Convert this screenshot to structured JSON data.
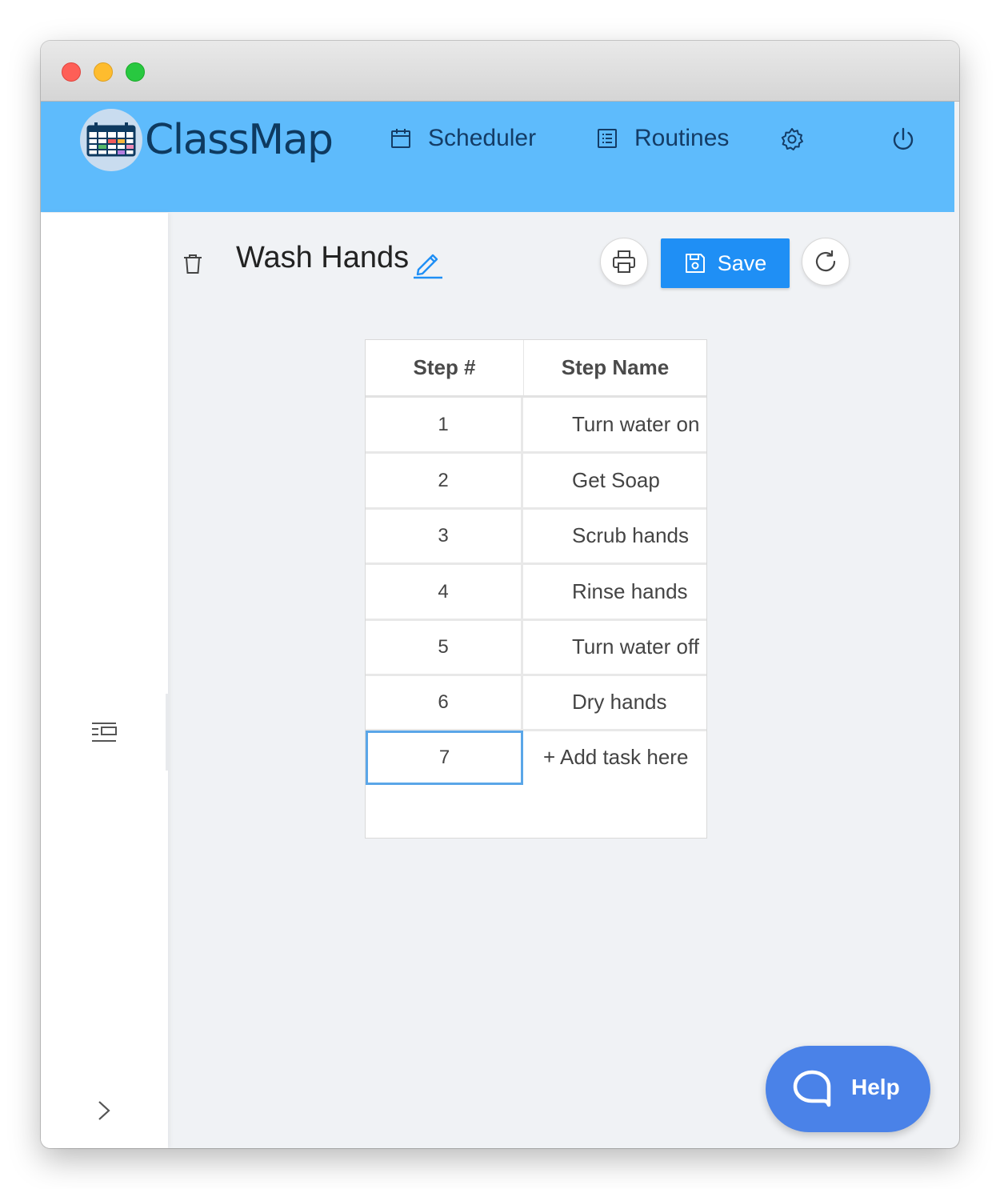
{
  "app": {
    "name": "ClassMap"
  },
  "nav": {
    "scheduler_label": "Scheduler",
    "routines_label": "Routines"
  },
  "routine": {
    "title": "Wash Hands"
  },
  "toolbar": {
    "save_label": "Save"
  },
  "table": {
    "columns": [
      "Step #",
      "Step Name"
    ],
    "rows": [
      {
        "num": "1",
        "name": "Turn water on"
      },
      {
        "num": "2",
        "name": "Get Soap"
      },
      {
        "num": "3",
        "name": "Scrub hands"
      },
      {
        "num": "4",
        "name": "Rinse hands"
      },
      {
        "num": "5",
        "name": "Turn water off"
      },
      {
        "num": "6",
        "name": "Dry hands"
      },
      {
        "num": "7",
        "name": "+ Add task here"
      }
    ]
  },
  "help": {
    "label": "Help"
  },
  "icons": {
    "scheduler": "calendar-icon",
    "routines": "list-icon",
    "settings": "gear-icon",
    "power": "power-icon",
    "delete": "trash-icon",
    "edit": "pencil-icon",
    "print": "printer-icon",
    "save": "floppy-disk-icon",
    "refresh": "refresh-icon",
    "sidebar_toggle": "indent-list-icon",
    "expand": "chevron-right-icon",
    "help": "chat-bubble-icon"
  },
  "colors": {
    "appbar": "#5ebbfc",
    "primary": "#1f8ff5",
    "help_button": "#4a82e8",
    "logo_text": "#0e3a60",
    "selected_cell_border": "#5aa6e8"
  }
}
